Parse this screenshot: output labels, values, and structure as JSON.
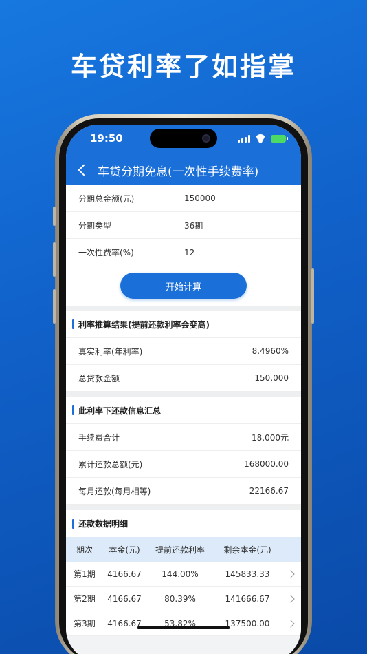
{
  "headline": "车贷利率了如指掌",
  "status": {
    "time": "19:50"
  },
  "nav": {
    "title": "车贷分期免息(一次性手续费率)"
  },
  "inputs": [
    {
      "label": "分期总金额(元)",
      "value": "150000"
    },
    {
      "label": "分期类型",
      "value": "36期"
    },
    {
      "label": "一次性费率(%)",
      "value": "12"
    }
  ],
  "calc_button": "开始计算",
  "rate_section": {
    "title": "利率推算结果(提前还款利率会变高)",
    "rows": [
      {
        "label": "真实利率(年利率)",
        "value": "8.4960%"
      },
      {
        "label": "总贷款金额",
        "value": "150,000"
      }
    ]
  },
  "summary_section": {
    "title": "此利率下还款信息汇总",
    "rows": [
      {
        "label": "手续费合计",
        "value": "18,000元"
      },
      {
        "label": "累计还款总额(元)",
        "value": "168000.00"
      },
      {
        "label": "每月还款(每月相等)",
        "value": "22166.67"
      }
    ]
  },
  "detail_section": {
    "title": "还款数据明细",
    "headers": [
      "期次",
      "本金(元)",
      "提前还款利率",
      "剩余本金(元)"
    ],
    "rows": [
      [
        "第1期",
        "4166.67",
        "144.00%",
        "145833.33"
      ],
      [
        "第2期",
        "4166.67",
        "80.39%",
        "141666.67"
      ],
      [
        "第3期",
        "4166.67",
        "53.82%",
        "137500.00"
      ]
    ]
  },
  "colors": {
    "accent": "#1a6fd9",
    "background": "#1466d0",
    "table_header": "#dceaf9"
  }
}
